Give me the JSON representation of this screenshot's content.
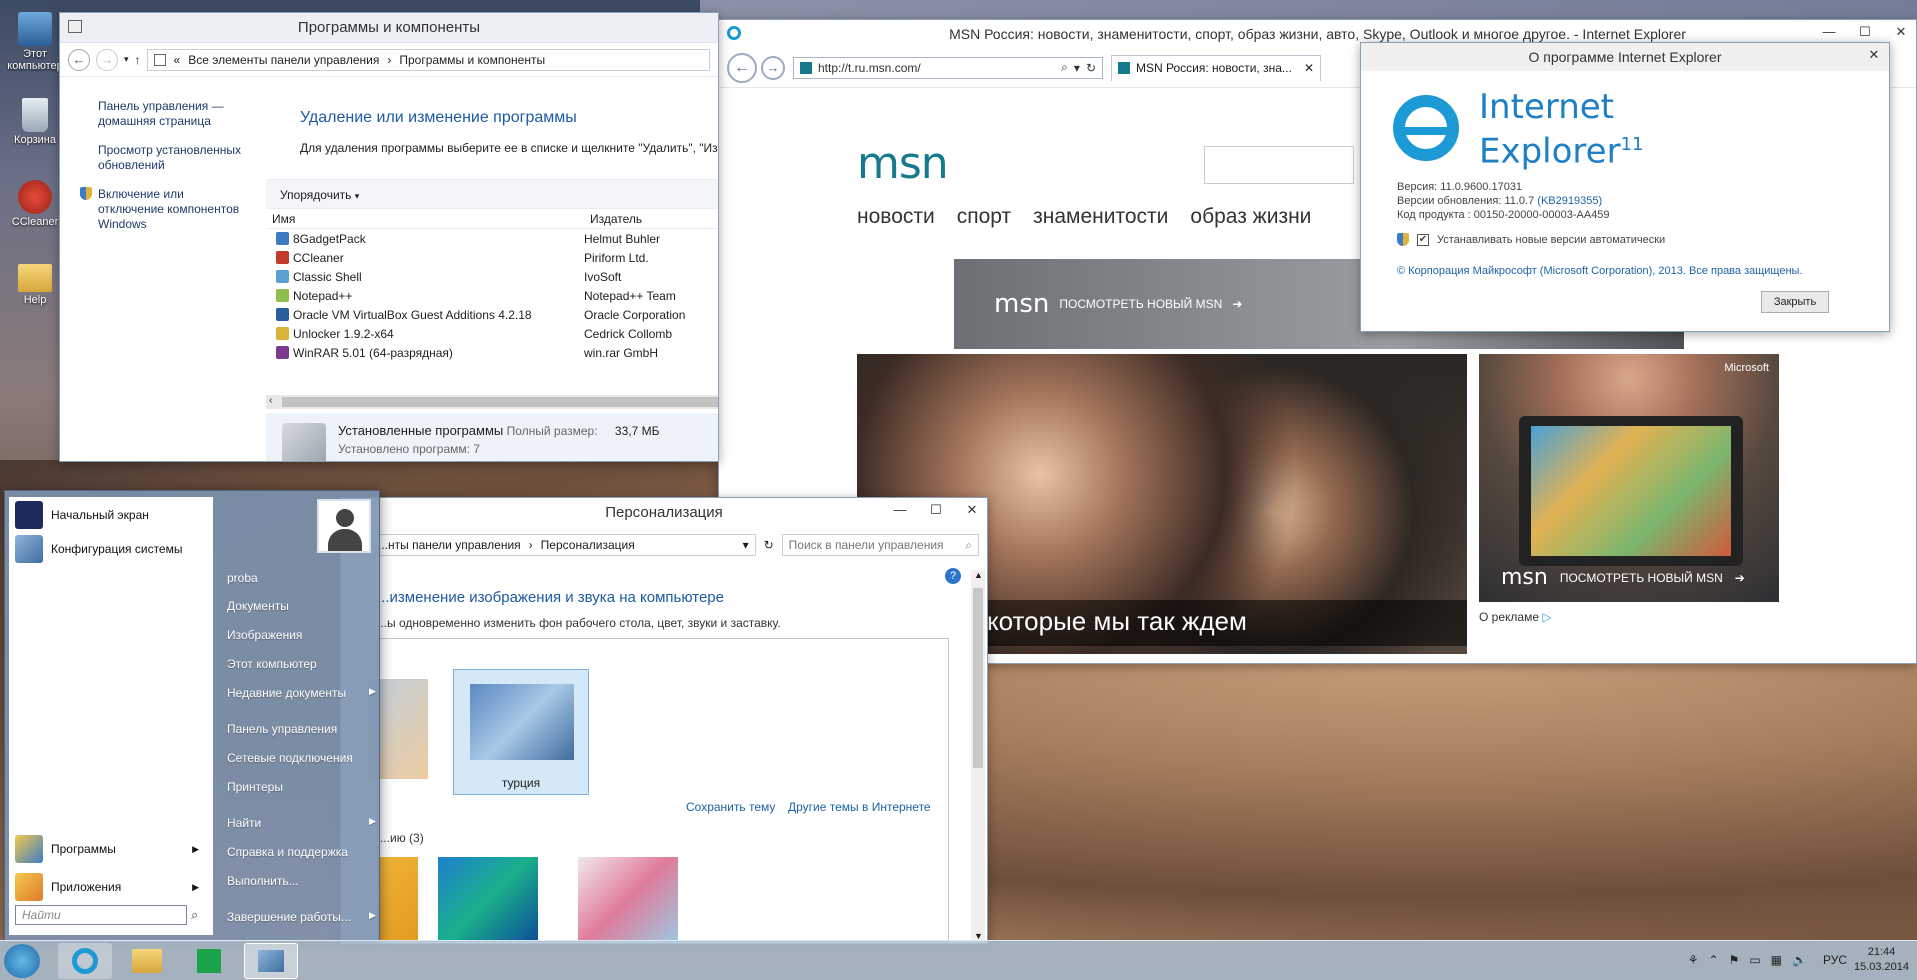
{
  "desktop": {
    "icons": [
      {
        "label": "Этот компьютер"
      },
      {
        "label": "Корзина"
      },
      {
        "label": "CCleaner"
      },
      {
        "label": "Help"
      }
    ]
  },
  "programs_window": {
    "title": "Программы и компоненты",
    "breadcrumb": [
      "Все элементы панели управления",
      "Программы и компоненты"
    ],
    "left_links": [
      "Панель управления — домашняя страница",
      "Просмотр установленных обновлений",
      "Включение или отключение компонентов Windows"
    ],
    "heading": "Удаление или изменение программы",
    "description": "Для удаления программы выберите ее в списке и щелкните \"Удалить\", \"Из",
    "toolbar": {
      "organize": "Упорядочить"
    },
    "columns": {
      "name": "Имя",
      "publisher": "Издатель"
    },
    "rows": [
      {
        "name": "8GadgetPack",
        "publisher": "Helmut Buhler",
        "color": "#3d7ac2"
      },
      {
        "name": "CCleaner",
        "publisher": "Piriform Ltd.",
        "color": "#c23a2c"
      },
      {
        "name": "Classic Shell",
        "publisher": "IvoSoft",
        "color": "#5aa0d2"
      },
      {
        "name": "Notepad++",
        "publisher": "Notepad++ Team",
        "color": "#8fbf4a"
      },
      {
        "name": "Oracle VM VirtualBox Guest Additions 4.2.18",
        "publisher": "Oracle Corporation",
        "color": "#2a5f9e"
      },
      {
        "name": "Unlocker 1.9.2-x64",
        "publisher": "Cedrick Collomb",
        "color": "#d8b43a"
      },
      {
        "name": "WinRAR 5.01 (64-разрядная)",
        "publisher": "win.rar GmbH",
        "color": "#7b3a8c"
      }
    ],
    "status": {
      "label": "Установленные программы",
      "size_label": "Полный размер:",
      "size_value": "33,7 МБ",
      "count": "Установлено программ: 7"
    }
  },
  "ie_window": {
    "title": "MSN Россия: новости, знаменитости, спорт, образ жизни, авто, Skype, Outlook и многое другое. - Internet Explorer",
    "url": "http://t.ru.msn.com/",
    "tab_label": "MSN Россия: новости, зна...",
    "msn_logo": "msn",
    "nav": [
      "новости",
      "спорт",
      "знаменитости",
      "образ жизни"
    ],
    "banner_text": "ПОСМОТРЕТЬ НОВЫЙ MSN",
    "hero_caption": "которые мы так ждем",
    "ad_brand": "Microsoft",
    "ad_text": "ПОСМОТРЕТЬ НОВЫЙ MSN",
    "ad_label": "О рекламе"
  },
  "about_dialog": {
    "title": "О программе Internet Explorer",
    "product_line1": "Internet",
    "product_line2": "Explorer",
    "version_num": "11",
    "version": "Версия: 11.0.9600.17031",
    "update_version_label": "Версии обновления: 11.0.7",
    "update_kb": "(KB2919355)",
    "product_code": "Код продукта : 00150-20000-00003-AA459",
    "auto_update": "Устанавливать новые версии автоматически",
    "copyright": "© Корпорация Майкрософт (Microsoft Corporation), 2013. Все права защищены.",
    "close_button": "Закрыть"
  },
  "personalization_window": {
    "title": "Персонализация",
    "breadcrumb": [
      "...нты панели управления",
      "Персонализация"
    ],
    "search_placeholder": "Поиск в панели управления",
    "heading": "...изменение изображения и звука на компьютере",
    "description": "...ы одновременно изменить фон рабочего стола, цвет, звуки и заставку.",
    "selected_theme": "турция",
    "save_theme": "Сохранить тему",
    "more_themes": "Другие темы в Интернете",
    "section_count": "...ию (3)"
  },
  "start_menu": {
    "pinned": [
      {
        "label": "Начальный экран"
      },
      {
        "label": "Конфигурация системы"
      }
    ],
    "bottom": [
      {
        "label": "Программы"
      },
      {
        "label": "Приложения"
      }
    ],
    "search_placeholder": "Найти",
    "right": [
      "proba",
      "Документы",
      "Изображения",
      "Этот компьютер",
      "Недавние документы",
      "Панель управления",
      "Сетевые подключения",
      "Принтеры",
      "Найти",
      "Справка и поддержка",
      "Выполнить...",
      "Завершение работы..."
    ]
  },
  "taskbar": {
    "lang": "РУС",
    "time": "21:44",
    "date": "15.03.2014"
  }
}
